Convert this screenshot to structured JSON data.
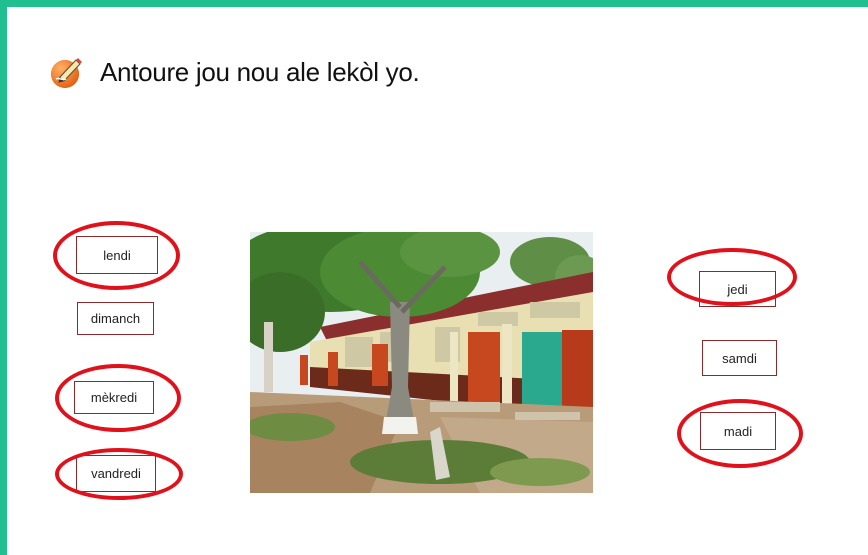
{
  "instruction": {
    "text": "Antoure jou nou ale lekòl yo.",
    "icon": "pencil-icon"
  },
  "days": {
    "lendi": "lendi",
    "dimanch": "dimanch",
    "mekredi": "mèkredi",
    "vandredi": "vandredi",
    "jedi": "jedi",
    "samdi": "samdi",
    "madi": "madi"
  },
  "circled": [
    "lendi",
    "mèkredi",
    "vandredi",
    "jedi",
    "madi"
  ],
  "colors": {
    "frame": "#1fbf8f",
    "circle": "#e1111c",
    "box_border": "#8a2a2a"
  }
}
